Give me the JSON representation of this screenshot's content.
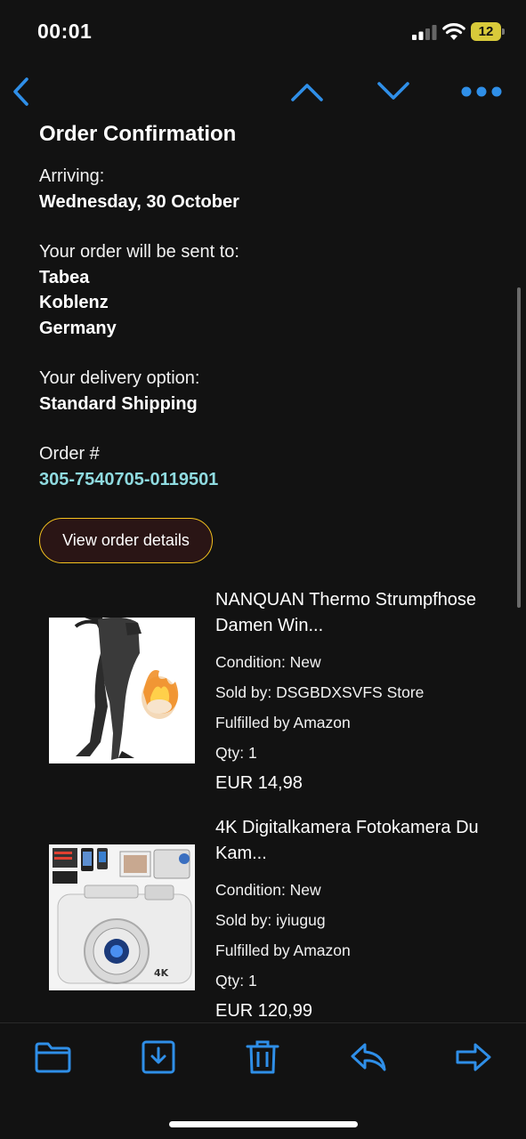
{
  "status_bar": {
    "time": "00:01",
    "battery": "12"
  },
  "nav": {
    "icons": [
      "chevron-left-icon",
      "chevron-up-icon",
      "chevron-down-icon",
      "more-dots-icon"
    ],
    "accent_color": "#2f8fe8"
  },
  "email": {
    "title": "Order Confirmation",
    "arriving_label": "Arriving:",
    "arriving_date": "Wednesday, 30 October",
    "sent_to_label": "Your order will be sent to:",
    "address": [
      "Tabea",
      "Koblenz",
      "Germany"
    ],
    "delivery_label": "Your delivery option:",
    "delivery_option": "Standard Shipping",
    "order_label": "Order #",
    "order_number": "305-7540705-0119501",
    "view_button": "View order details"
  },
  "products": [
    {
      "title": "NANQUAN Thermo Strumpfhose",
      "title_line2": "Damen Win...",
      "condition": "Condition: New",
      "sold_by": "Sold by: DSGBDXSVFS Store",
      "fulfilled": "Fulfilled by Amazon",
      "qty": "Qty: 1",
      "price": "EUR 14,98"
    },
    {
      "title": "4K Digitalkamera Fotokamera Du",
      "title_line2": "Kam...",
      "condition": "Condition: New",
      "sold_by": "Sold by: iyiugug",
      "fulfilled": "Fulfilled by Amazon",
      "qty": "Qty: 1",
      "price": "EUR 120,99"
    }
  ],
  "toolbar": {
    "icons": [
      "folder-icon",
      "archive-download-icon",
      "trash-icon",
      "reply-icon",
      "forward-icon"
    ]
  }
}
